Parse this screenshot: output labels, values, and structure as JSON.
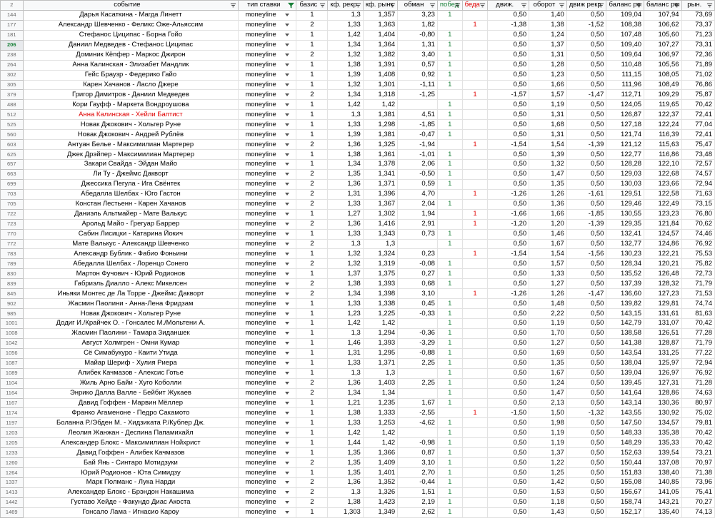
{
  "header_row_num": "2",
  "columns": [
    {
      "label": "событие",
      "filter_active": false,
      "color": ""
    },
    {
      "label": "тип ставки",
      "filter_active": true,
      "color": ""
    },
    {
      "label": "базис",
      "filter_active": false,
      "color": ""
    },
    {
      "label": "кф. рекр",
      "filter_active": false,
      "color": ""
    },
    {
      "label": "кф. рынк",
      "filter_active": false,
      "color": ""
    },
    {
      "label": "обман",
      "filter_active": false,
      "color": ""
    },
    {
      "label": "побед",
      "filter_active": false,
      "color": "#188038"
    },
    {
      "label": "беда",
      "filter_active": false,
      "color": "#e00000"
    },
    {
      "label": "движ.",
      "filter_active": false,
      "color": ""
    },
    {
      "label": "оборот",
      "filter_active": false,
      "color": ""
    },
    {
      "label": "движ рекр",
      "filter_active": false,
      "color": ""
    },
    {
      "label": "баланс рек",
      "filter_active": false,
      "color": ""
    },
    {
      "label": "баланс рек",
      "filter_active": false,
      "color": ""
    },
    {
      "label": "рын.",
      "filter_active": false,
      "color": ""
    }
  ],
  "colors": {
    "win": "#188038",
    "loss": "#e00000",
    "highlight_row_text": "#e00000"
  },
  "rows": [
    {
      "n": "144",
      "event": "Дарья Касаткина - Магда Линетт",
      "type": "moneyline",
      "basis": "1",
      "k1": "1,3",
      "k2": "1,357",
      "d": "3,23",
      "w": "1",
      "l": "",
      "mv": "0,50",
      "turn": "1,40",
      "mr": "0,50",
      "b1": "109,04",
      "b2": "107,94",
      "m": "73,69"
    },
    {
      "n": "177",
      "event": "Александр Шевченко - Феликс Оже-Альяссим",
      "type": "moneyline",
      "basis": "2",
      "k1": "1,33",
      "k2": "1,363",
      "d": "1,82",
      "w": "",
      "l": "1",
      "mv": "-1,38",
      "turn": "1,38",
      "mr": "-1,52",
      "b1": "108,38",
      "b2": "106,62",
      "m": "73,37"
    },
    {
      "n": "181",
      "event": "Стефанос Циципас - Борна Гойо",
      "type": "moneyline",
      "basis": "1",
      "k1": "1,42",
      "k2": "1,404",
      "d": "-0,80",
      "w": "1",
      "l": "",
      "mv": "0,50",
      "turn": "1,24",
      "mr": "0,50",
      "b1": "107,48",
      "b2": "105,60",
      "m": "71,23"
    },
    {
      "n": "206",
      "event": "Даниил Медведев - Стефанос Циципас",
      "type": "moneyline",
      "basis": "1",
      "k1": "1,34",
      "k2": "1,364",
      "d": "1,31",
      "w": "1",
      "l": "",
      "mv": "0,50",
      "turn": "1,37",
      "mr": "0,50",
      "b1": "109,40",
      "b2": "107,27",
      "m": "73,31",
      "sel": true
    },
    {
      "n": "238",
      "event": "Доминик Кёпфер - Маркос Джирон",
      "type": "moneyline",
      "basis": "2",
      "k1": "1,32",
      "k2": "1,382",
      "d": "3,40",
      "w": "1",
      "l": "",
      "mv": "0,50",
      "turn": "1,31",
      "mr": "0,50",
      "b1": "109,64",
      "b2": "106,97",
      "m": "72,36"
    },
    {
      "n": "264",
      "event": "Анна Калинская - Элизабет Мандлик",
      "type": "moneyline",
      "basis": "1",
      "k1": "1,38",
      "k2": "1,391",
      "d": "0,57",
      "w": "1",
      "l": "",
      "mv": "0,50",
      "turn": "1,28",
      "mr": "0,50",
      "b1": "110,48",
      "b2": "105,56",
      "m": "71,89"
    },
    {
      "n": "302",
      "event": "Гейс Браузр - Федерико Гайо",
      "type": "moneyline",
      "basis": "1",
      "k1": "1,39",
      "k2": "1,408",
      "d": "0,92",
      "w": "1",
      "l": "",
      "mv": "0,50",
      "turn": "1,23",
      "mr": "0,50",
      "b1": "111,15",
      "b2": "108,05",
      "m": "71,02"
    },
    {
      "n": "305",
      "event": "Карен Хачанов - Ласло Джере",
      "type": "moneyline",
      "basis": "1",
      "k1": "1,32",
      "k2": "1,301",
      "d": "-1,11",
      "w": "1",
      "l": "",
      "mv": "0,50",
      "turn": "1,66",
      "mr": "0,50",
      "b1": "111,96",
      "b2": "108,49",
      "m": "76,86"
    },
    {
      "n": "379",
      "event": "Григор Димитров - Даниил Медведев",
      "type": "moneyline",
      "basis": "2",
      "k1": "1,34",
      "k2": "1,318",
      "d": "-1,25",
      "w": "",
      "l": "1",
      "mv": "-1,57",
      "turn": "1,57",
      "mr": "-1,47",
      "b1": "112,71",
      "b2": "109,29",
      "m": "75,87"
    },
    {
      "n": "488",
      "event": "Кори Гауфф - Маркета Вондроушова",
      "type": "moneyline",
      "basis": "1",
      "k1": "1,42",
      "k2": "1,42",
      "d": "",
      "w": "1",
      "l": "",
      "mv": "0,50",
      "turn": "1,19",
      "mr": "0,50",
      "b1": "124,05",
      "b2": "119,65",
      "m": "70,42"
    },
    {
      "n": "512",
      "event": "Анна Калинская - Хейли Баптист",
      "type": "moneyline",
      "basis": "1",
      "k1": "1,3",
      "k2": "1,381",
      "d": "4,51",
      "w": "1",
      "l": "",
      "mv": "0,50",
      "turn": "1,31",
      "mr": "0,50",
      "b1": "126,87",
      "b2": "122,37",
      "m": "72,41",
      "red": true
    },
    {
      "n": "525",
      "event": "Новак Джокович - Хольгер Руне",
      "type": "moneyline",
      "basis": "1",
      "k1": "1,33",
      "k2": "1,298",
      "d": "-1,85",
      "w": "1",
      "l": "",
      "mv": "0,50",
      "turn": "1,68",
      "mr": "0,50",
      "b1": "127,18",
      "b2": "122,24",
      "m": "77,04"
    },
    {
      "n": "560",
      "event": "Новак Джокович - Андрей Рублёв",
      "type": "moneyline",
      "basis": "1",
      "k1": "1,39",
      "k2": "1,381",
      "d": "-0,47",
      "w": "1",
      "l": "",
      "mv": "0,50",
      "turn": "1,31",
      "mr": "0,50",
      "b1": "121,74",
      "b2": "116,39",
      "m": "72,41"
    },
    {
      "n": "603",
      "event": "Антуан Белье - Максимилиан Мартерер",
      "type": "moneyline",
      "basis": "2",
      "k1": "1,36",
      "k2": "1,325",
      "d": "-1,94",
      "w": "",
      "l": "1",
      "mv": "-1,54",
      "turn": "1,54",
      "mr": "-1,39",
      "b1": "121,12",
      "b2": "115,63",
      "m": "75,47"
    },
    {
      "n": "625",
      "event": "Джек Дрэйпер - Максимилиан Мартерер",
      "type": "moneyline",
      "basis": "1",
      "k1": "1,38",
      "k2": "1,361",
      "d": "-1,01",
      "w": "1",
      "l": "",
      "mv": "0,50",
      "turn": "1,39",
      "mr": "0,50",
      "b1": "122,77",
      "b2": "116,86",
      "m": "73,48"
    },
    {
      "n": "657",
      "event": "Закари Свайда - Эйдан Майо",
      "type": "moneyline",
      "basis": "1",
      "k1": "1,34",
      "k2": "1,378",
      "d": "2,06",
      "w": "1",
      "l": "",
      "mv": "0,50",
      "turn": "1,32",
      "mr": "0,50",
      "b1": "128,28",
      "b2": "122,10",
      "m": "72,57"
    },
    {
      "n": "663",
      "event": "Ли Ту - Джеймс Дакворт",
      "type": "moneyline",
      "basis": "2",
      "k1": "1,35",
      "k2": "1,341",
      "d": "-0,50",
      "w": "1",
      "l": "",
      "mv": "0,50",
      "turn": "1,47",
      "mr": "0,50",
      "b1": "129,03",
      "b2": "122,68",
      "m": "74,57"
    },
    {
      "n": "699",
      "event": "Джессика Пегула - Ига Свёнтек",
      "type": "moneyline",
      "basis": "2",
      "k1": "1,36",
      "k2": "1,371",
      "d": "0,59",
      "w": "1",
      "l": "",
      "mv": "0,50",
      "turn": "1,35",
      "mr": "0,50",
      "b1": "130,03",
      "b2": "123,66",
      "m": "72,94"
    },
    {
      "n": "703",
      "event": "Абедалла Шелбах - Юго Гастон",
      "type": "moneyline",
      "basis": "2",
      "k1": "1,31",
      "k2": "1,396",
      "d": "4,70",
      "w": "",
      "l": "1",
      "mv": "-1,26",
      "turn": "1,26",
      "mr": "-1,61",
      "b1": "129,51",
      "b2": "122,58",
      "m": "71,63"
    },
    {
      "n": "705",
      "event": "Констан Лестьенн - Карен Хачанов",
      "type": "moneyline",
      "basis": "2",
      "k1": "1,33",
      "k2": "1,367",
      "d": "2,04",
      "w": "1",
      "l": "",
      "mv": "0,50",
      "turn": "1,36",
      "mr": "0,50",
      "b1": "129,46",
      "b2": "122,49",
      "m": "73,15"
    },
    {
      "n": "722",
      "event": "Даниэль Альтмайер - Мате Валькус",
      "type": "moneyline",
      "basis": "1",
      "k1": "1,27",
      "k2": "1,302",
      "d": "1,94",
      "w": "",
      "l": "1",
      "mv": "-1,66",
      "turn": "1,66",
      "mr": "-1,85",
      "b1": "130,55",
      "b2": "123,23",
      "m": "76,80"
    },
    {
      "n": "723",
      "event": "Арольд Майо - Грегуар Баррер",
      "type": "moneyline",
      "basis": "2",
      "k1": "1,36",
      "k2": "1,416",
      "d": "2,91",
      "w": "",
      "l": "1",
      "mv": "-1,20",
      "turn": "1,20",
      "mr": "-1,39",
      "b1": "129,35",
      "b2": "121,84",
      "m": "70,62"
    },
    {
      "n": "770",
      "event": "Сабин Лисицки - Катарина Йокич",
      "type": "moneyline",
      "basis": "1",
      "k1": "1,33",
      "k2": "1,343",
      "d": "0,73",
      "w": "1",
      "l": "",
      "mv": "0,50",
      "turn": "1,46",
      "mr": "0,50",
      "b1": "132,41",
      "b2": "124,57",
      "m": "74,46"
    },
    {
      "n": "772",
      "event": "Мате Валькус - Александр Шевченко",
      "type": "moneyline",
      "basis": "2",
      "k1": "1,3",
      "k2": "1,3",
      "d": "",
      "w": "1",
      "l": "",
      "mv": "0,50",
      "turn": "1,67",
      "mr": "0,50",
      "b1": "132,77",
      "b2": "124,86",
      "m": "76,92"
    },
    {
      "n": "783",
      "event": "Александр Бублик - Фабио Фоньини",
      "type": "moneyline",
      "basis": "1",
      "k1": "1,32",
      "k2": "1,324",
      "d": "0,23",
      "w": "",
      "l": "1",
      "mv": "-1,54",
      "turn": "1,54",
      "mr": "-1,56",
      "b1": "130,23",
      "b2": "122,21",
      "m": "75,53"
    },
    {
      "n": "789",
      "event": "Абедалла Шелбах - Лоренцо Сонего",
      "type": "moneyline",
      "basis": "2",
      "k1": "1,32",
      "k2": "1,319",
      "d": "-0,08",
      "w": "1",
      "l": "",
      "mv": "0,50",
      "turn": "1,57",
      "mr": "0,50",
      "b1": "128,34",
      "b2": "120,21",
      "m": "75,82"
    },
    {
      "n": "830",
      "event": "Мартон Фучович - Юрий Родионов",
      "type": "moneyline",
      "basis": "1",
      "k1": "1,37",
      "k2": "1,375",
      "d": "0,27",
      "w": "1",
      "l": "",
      "mv": "0,50",
      "turn": "1,33",
      "mr": "0,50",
      "b1": "135,52",
      "b2": "126,48",
      "m": "72,73"
    },
    {
      "n": "839",
      "event": "Габриэль Диалло - Алекс Микелсен",
      "type": "moneyline",
      "basis": "2",
      "k1": "1,38",
      "k2": "1,393",
      "d": "0,68",
      "w": "1",
      "l": "",
      "mv": "0,50",
      "turn": "1,27",
      "mr": "0,50",
      "b1": "137,39",
      "b2": "128,32",
      "m": "71,79"
    },
    {
      "n": "845",
      "event": "Иньяки Монтес де Ла Торре - Джеймс Дакворт",
      "type": "moneyline",
      "basis": "2",
      "k1": "1,34",
      "k2": "1,398",
      "d": "3,10",
      "w": "",
      "l": "1",
      "mv": "-1,26",
      "turn": "1,26",
      "mr": "-1,47",
      "b1": "136,60",
      "b2": "127,23",
      "m": "71,53"
    },
    {
      "n": "902",
      "event": "Жасмин Паолини - Анна-Лена Фридзам",
      "type": "moneyline",
      "basis": "1",
      "k1": "1,33",
      "k2": "1,338",
      "d": "0,45",
      "w": "1",
      "l": "",
      "mv": "0,50",
      "turn": "1,48",
      "mr": "0,50",
      "b1": "139,82",
      "b2": "129,81",
      "m": "74,74"
    },
    {
      "n": "985",
      "event": "Новак Джокович - Хольгер Руне",
      "type": "moneyline",
      "basis": "1",
      "k1": "1,23",
      "k2": "1,225",
      "d": "-0,33",
      "w": "1",
      "l": "",
      "mv": "0,50",
      "turn": "2,22",
      "mr": "0,50",
      "b1": "143,15",
      "b2": "131,61",
      "m": "81,63"
    },
    {
      "n": "1001",
      "event": "Додиг И./Крайчек О. - Гонсалес М./Мольтени А.",
      "type": "moneyline",
      "basis": "1",
      "k1": "1,42",
      "k2": "1,42",
      "d": "",
      "w": "1",
      "l": "",
      "mv": "0,50",
      "turn": "1,19",
      "mr": "0,50",
      "b1": "142,79",
      "b2": "131,07",
      "m": "70,42"
    },
    {
      "n": "1008",
      "event": "Жасмин Паолини - Тамара Зиданшек",
      "type": "moneyline",
      "basis": "1",
      "k1": "1,3",
      "k2": "1,294",
      "d": "-0,36",
      "w": "1",
      "l": "",
      "mv": "0,50",
      "turn": "1,70",
      "mr": "0,50",
      "b1": "138,58",
      "b2": "126,51",
      "m": "77,28"
    },
    {
      "n": "1042",
      "event": "Август Холмгрен - Омни Кумар",
      "type": "moneyline",
      "basis": "1",
      "k1": "1,46",
      "k2": "1,393",
      "d": "-3,29",
      "w": "1",
      "l": "",
      "mv": "0,50",
      "turn": "1,27",
      "mr": "0,50",
      "b1": "141,38",
      "b2": "128,87",
      "m": "71,79"
    },
    {
      "n": "1056",
      "event": "Сё Симабукуро - Каити Утида",
      "type": "moneyline",
      "basis": "1",
      "k1": "1,31",
      "k2": "1,295",
      "d": "-0,88",
      "w": "1",
      "l": "",
      "mv": "0,50",
      "turn": "1,69",
      "mr": "0,50",
      "b1": "143,54",
      "b2": "131,25",
      "m": "77,22"
    },
    {
      "n": "1087",
      "event": "Майар Шериф - Хулия Риера",
      "type": "moneyline",
      "basis": "1",
      "k1": "1,33",
      "k2": "1,371",
      "d": "2,25",
      "w": "1",
      "l": "",
      "mv": "0,50",
      "turn": "1,35",
      "mr": "0,50",
      "b1": "138,04",
      "b2": "125,97",
      "m": "72,94"
    },
    {
      "n": "1089",
      "event": "Алибек Качмазов - Алексис Готье",
      "type": "moneyline",
      "basis": "1",
      "k1": "1,3",
      "k2": "1,3",
      "d": "",
      "w": "1",
      "l": "",
      "mv": "0,50",
      "turn": "1,67",
      "mr": "0,50",
      "b1": "139,04",
      "b2": "126,97",
      "m": "76,92"
    },
    {
      "n": "1104",
      "event": "Жиль Арно Байи - Хуго Коболли",
      "type": "moneyline",
      "basis": "2",
      "k1": "1,36",
      "k2": "1,403",
      "d": "2,25",
      "w": "1",
      "l": "",
      "mv": "0,50",
      "turn": "1,24",
      "mr": "0,50",
      "b1": "139,45",
      "b2": "127,31",
      "m": "71,28"
    },
    {
      "n": "1164",
      "event": "Энрико Далла Валле - Бейбит Жукаев",
      "type": "moneyline",
      "basis": "2",
      "k1": "1,34",
      "k2": "1,34",
      "d": "",
      "w": "1",
      "l": "",
      "mv": "0,50",
      "turn": "1,47",
      "mr": "0,50",
      "b1": "141,64",
      "b2": "128,86",
      "m": "74,63"
    },
    {
      "n": "1167",
      "event": "Давид Гоффен - Марвин Мёллер",
      "type": "moneyline",
      "basis": "1",
      "k1": "1,21",
      "k2": "1,235",
      "d": "1,67",
      "w": "1",
      "l": "",
      "mv": "0,50",
      "turn": "2,13",
      "mr": "0,50",
      "b1": "143,14",
      "b2": "130,36",
      "m": "80,97"
    },
    {
      "n": "1174",
      "event": "Франко Агаменоне - Педро Сакамото",
      "type": "moneyline",
      "basis": "1",
      "k1": "1,38",
      "k2": "1,333",
      "d": "-2,55",
      "w": "",
      "l": "1",
      "mv": "-1,50",
      "turn": "1,50",
      "mr": "-1,32",
      "b1": "143,55",
      "b2": "130,92",
      "m": "75,02"
    },
    {
      "n": "1197",
      "event": "Боланна Р./Эбден М. - Хидзиката Р./Кублер Дж.",
      "type": "moneyline",
      "basis": "1",
      "k1": "1,33",
      "k2": "1,253",
      "d": "-4,62",
      "w": "1",
      "l": "",
      "mv": "0,50",
      "turn": "1,98",
      "mr": "0,50",
      "b1": "147,50",
      "b2": "134,57",
      "m": "79,81"
    },
    {
      "n": "1203",
      "event": "Леолия Жанжан - Деспина Папамихайл",
      "type": "moneyline",
      "basis": "1",
      "k1": "1,42",
      "k2": "1,42",
      "d": "",
      "w": "1",
      "l": "",
      "mv": "0,50",
      "turn": "1,19",
      "mr": "0,50",
      "b1": "148,33",
      "b2": "135,38",
      "m": "70,42"
    },
    {
      "n": "1205",
      "event": "Александер Блокс - Максимилиан Нойхрист",
      "type": "moneyline",
      "basis": "1",
      "k1": "1,44",
      "k2": "1,42",
      "d": "-0,98",
      "w": "1",
      "l": "",
      "mv": "0,50",
      "turn": "1,19",
      "mr": "0,50",
      "b1": "148,29",
      "b2": "135,33",
      "m": "70,42"
    },
    {
      "n": "1233",
      "event": "Давид Гоффен - Алибек Качмазов",
      "type": "moneyline",
      "basis": "1",
      "k1": "1,35",
      "k2": "1,366",
      "d": "0,87",
      "w": "1",
      "l": "",
      "mv": "0,50",
      "turn": "1,37",
      "mr": "0,50",
      "b1": "152,63",
      "b2": "139,54",
      "m": "73,21"
    },
    {
      "n": "1260",
      "event": "Бай Янь - Синтаро Мотидзуки",
      "type": "moneyline",
      "basis": "2",
      "k1": "1,35",
      "k2": "1,409",
      "d": "3,10",
      "w": "1",
      "l": "",
      "mv": "0,50",
      "turn": "1,22",
      "mr": "0,50",
      "b1": "150,44",
      "b2": "137,08",
      "m": "70,97"
    },
    {
      "n": "1264",
      "event": "Юрий Родионов - Юта Симидзу",
      "type": "moneyline",
      "basis": "1",
      "k1": "1,35",
      "k2": "1,401",
      "d": "2,70",
      "w": "1",
      "l": "",
      "mv": "0,50",
      "turn": "1,25",
      "mr": "0,50",
      "b1": "151,83",
      "b2": "138,40",
      "m": "71,38"
    },
    {
      "n": "1337",
      "event": "Марк Полманс - Лука Нарди",
      "type": "moneyline",
      "basis": "2",
      "k1": "1,36",
      "k2": "1,352",
      "d": "-0,44",
      "w": "1",
      "l": "",
      "mv": "0,50",
      "turn": "1,42",
      "mr": "0,50",
      "b1": "155,08",
      "b2": "140,85",
      "m": "73,96"
    },
    {
      "n": "1413",
      "event": "Александер Блокс - Брэндон Накашима",
      "type": "moneyline",
      "basis": "2",
      "k1": "1,3",
      "k2": "1,326",
      "d": "1,51",
      "w": "1",
      "l": "",
      "mv": "0,50",
      "turn": "1,53",
      "mr": "0,50",
      "b1": "156,67",
      "b2": "141,05",
      "m": "75,41"
    },
    {
      "n": "1442",
      "event": "Густаво Хейде - Факундо Диас Акоста",
      "type": "moneyline",
      "basis": "2",
      "k1": "1,38",
      "k2": "1,423",
      "d": "2,19",
      "w": "1",
      "l": "",
      "mv": "0,50",
      "turn": "1,18",
      "mr": "0,50",
      "b1": "158,74",
      "b2": "143,21",
      "m": "70,27"
    },
    {
      "n": "1469",
      "event": "Гонсало Лама - Игнасио Кароу",
      "type": "moneyline",
      "basis": "1",
      "k1": "1,303",
      "k2": "1,349",
      "d": "2,62",
      "w": "1",
      "l": "",
      "mv": "0,50",
      "turn": "1,43",
      "mr": "0,50",
      "b1": "152,17",
      "b2": "135,40",
      "m": "74,13"
    }
  ]
}
